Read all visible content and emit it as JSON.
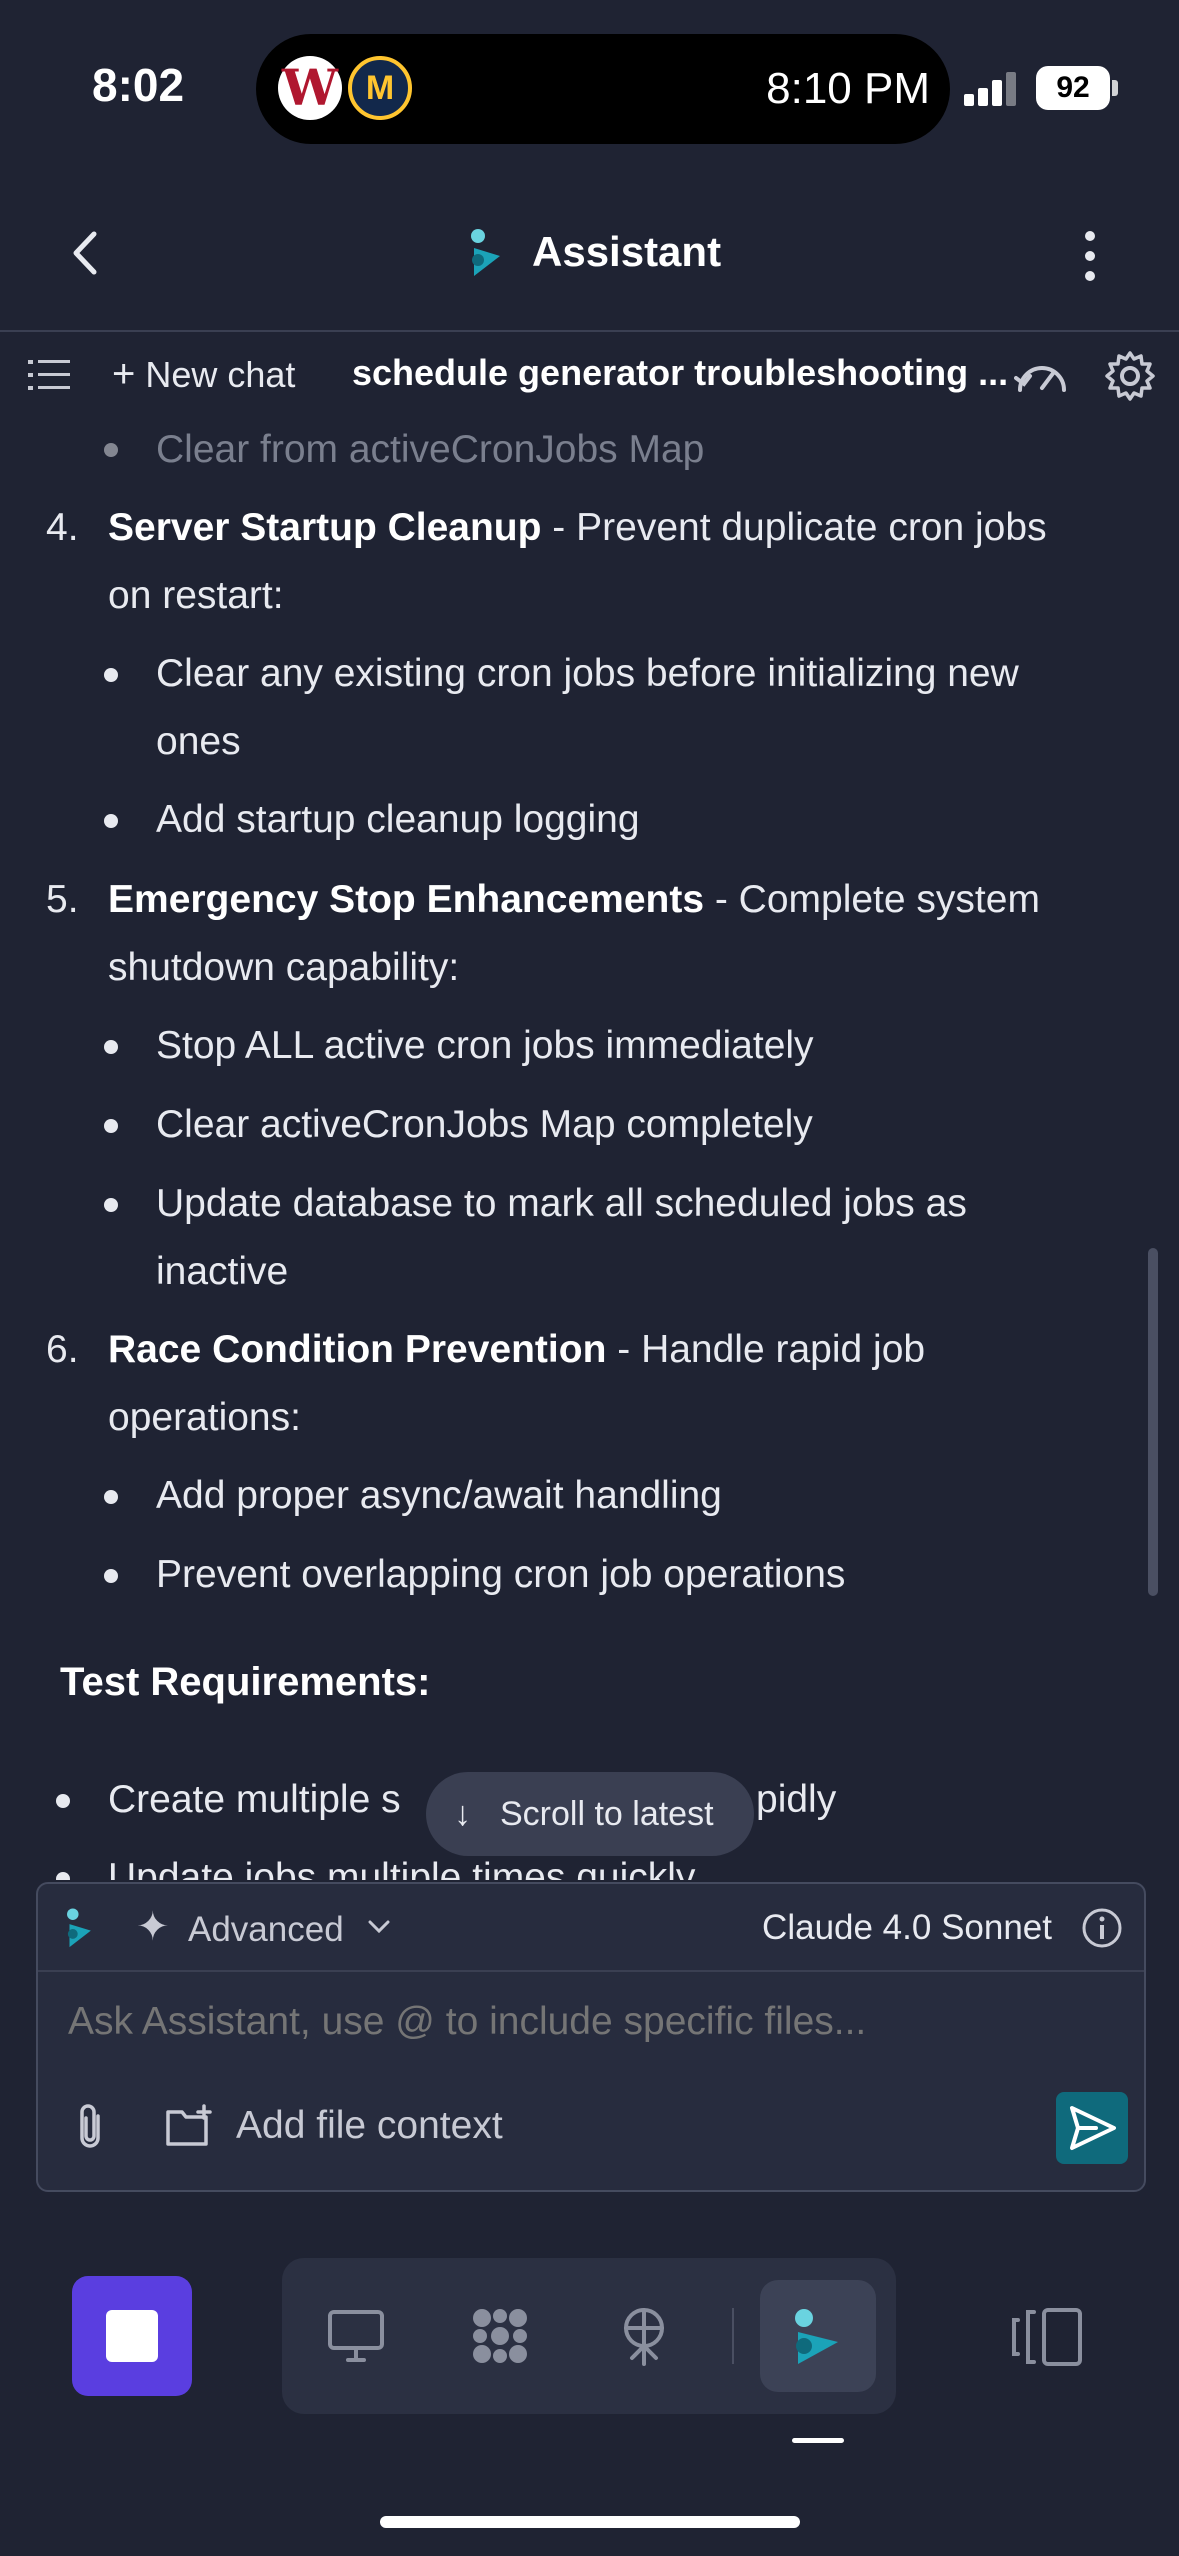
{
  "status_bar": {
    "time": "8:02",
    "live_activity_time": "8:10 PM",
    "battery": "92",
    "team_logo_1": "W",
    "team_logo_2": "M"
  },
  "header": {
    "title": "Assistant",
    "back_icon": "chevron-left-icon",
    "menu_icon": "vertical-dots-icon"
  },
  "toolbar": {
    "new_chat_label": "New chat",
    "chat_title": "schedule generator troubleshooting ..."
  },
  "content": {
    "faded_bullet": "Clear from activeCronJobs Map",
    "items": [
      {
        "number": "4.",
        "title": "Server Startup Cleanup",
        "desc_line1": " - Prevent duplicate cron jobs",
        "desc_line2": "on restart:",
        "bullets": [
          [
            "Clear any existing cron jobs before initializing new",
            "ones"
          ],
          [
            "Add startup cleanup logging"
          ]
        ]
      },
      {
        "number": "5.",
        "title": "Emergency Stop Enhancements",
        "desc_line1": " - Complete system",
        "desc_line2": "shutdown capability:",
        "bullets": [
          [
            "Stop ALL active cron jobs immediately"
          ],
          [
            "Clear activeCronJobs Map completely"
          ],
          [
            "Update database to mark all scheduled jobs as",
            "inactive"
          ]
        ]
      },
      {
        "number": "6.",
        "title": "Race Condition Prevention",
        "desc_line1": " - Handle rapid job",
        "desc_line2": "operations:",
        "bullets": [
          [
            "Add proper async/await handling"
          ],
          [
            "Prevent overlapping cron job operations"
          ]
        ]
      }
    ],
    "test_heading": "Test Requirements:",
    "test_bullet_1_start": "Create multiple s",
    "test_bullet_1_end": "pidly",
    "test_bullet_2": "Update jobs multiple times quickly"
  },
  "scroll_to_latest": {
    "arrow": "↓",
    "label": "Scroll to latest"
  },
  "composer": {
    "mode": "Advanced",
    "model": "Claude 4.0 Sonnet",
    "placeholder": "Ask Assistant, use @ to include specific files...",
    "add_file_context": "Add file context"
  },
  "dock": {
    "items": [
      "desktop-icon",
      "grid-flower-icon",
      "antenna-icon",
      "assistant-logo-icon"
    ],
    "active": "assistant-logo-icon"
  },
  "colors": {
    "background": "#1f2333",
    "accent_teal": "#1ba3b8",
    "send_button": "#0f6a7c",
    "stop_button": "#5a3ee0"
  }
}
